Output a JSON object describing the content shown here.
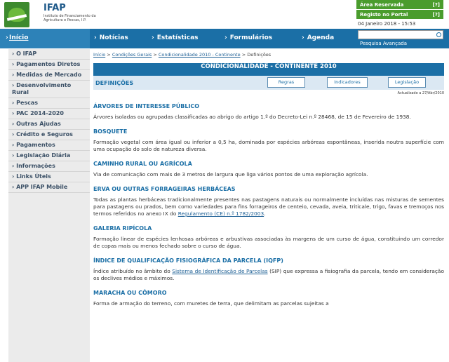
{
  "header": {
    "logo_name": "IFAP",
    "logo_subtitle": "Instituto de Financiamento da Agricultura e Pescas, I.P.",
    "area_reservada": "Área Reservada",
    "registo": "Registo no Portal",
    "help": "[?]",
    "date": "04 Janeiro 2018 - 15:53"
  },
  "topnav": {
    "home": "Início",
    "items": [
      "Notícias",
      "Estatísticas",
      "Formulários",
      "Agenda"
    ],
    "search_placeholder": "",
    "search_link": "Pesquisa Avançada"
  },
  "sidebar": {
    "items": [
      "O IFAP",
      "Pagamentos Diretos",
      "Medidas de Mercado",
      "Desenvolvimento Rural",
      "Pescas",
      "PAC 2014-2020",
      "Outras Ajudas",
      "Crédito e Seguros",
      "Pagamentos",
      "Legislação Diária",
      "Informações",
      "Links Úteis",
      "APP IFAP Mobile"
    ]
  },
  "breadcrumb": {
    "items": [
      "Início",
      "Condições Gerais",
      "Condicionalidade 2010 - Continente"
    ],
    "current": "Definições",
    "separator": ">"
  },
  "page": {
    "title": "CONDICIONALIDADE - CONTINENTE 2010",
    "section": "DEFINIÇÕES",
    "tabs": [
      "Regras",
      "Indicadores",
      "Legislação"
    ],
    "updated": "Actualizado a 27/Abr/2010"
  },
  "definitions": [
    {
      "term": "ÁRVORES DE INTERESSE PÚBLICO",
      "text": "Árvores isoladas ou agrupadas classificadas ao abrigo do artigo 1.º do Decreto-Lei n.º 28468, de 15 de Fevereiro de 1938."
    },
    {
      "term": "BOSQUETE",
      "text": "Formação vegetal com área igual ou inferior a 0,5 ha, dominada por espécies arbóreas espontâneas, inserida noutra superfície com uma ocupação do solo de natureza diversa."
    },
    {
      "term": "CAMINHO RURAL OU AGRÍCOLA",
      "text": "Via de comunicação com mais de 3 metros de largura que liga vários pontos de uma exploração agrícola."
    },
    {
      "term": "ERVA OU OUTRAS FORRAGEIRAS HERBÁCEAS",
      "text": "Todas as plantas herbáceas tradicionalmente presentes nas pastagens naturais ou normalmente incluídas nas misturas de sementes para pastagens ou prados, bem como variedades para fins forrageiros de centeio, cevada, aveia, triticale, trigo, favas e tremoços nos termos referidos no anexo IX do ",
      "link": "Regulamento (CE) n.º 1782/2003",
      "text_after": "."
    },
    {
      "term": "GALERIA RIPÍCOLA",
      "text": "Formação linear de espécies lenhosas arbóreas e arbustivas associadas às margens de um curso de água, constituindo um corredor de copas mais ou menos fechado sobre o curso de água."
    },
    {
      "term": "ÍNDICE DE QUALIFICAÇÃO FISIOGRÁFICA DA PARCELA (IQFP)",
      "text": "Índice atribuído no âmbito do ",
      "link": "Sistema de Identificação de Parcelas",
      "text_after": " (SIP) que expressa a fisiografia da parcela, tendo em consideração os declives médios e máximos."
    },
    {
      "term": "MARACHA OU CÔMORO",
      "text": "Forma de armação do terreno, com muretes de terra, que delimitam as parcelas sujeitas a"
    }
  ]
}
